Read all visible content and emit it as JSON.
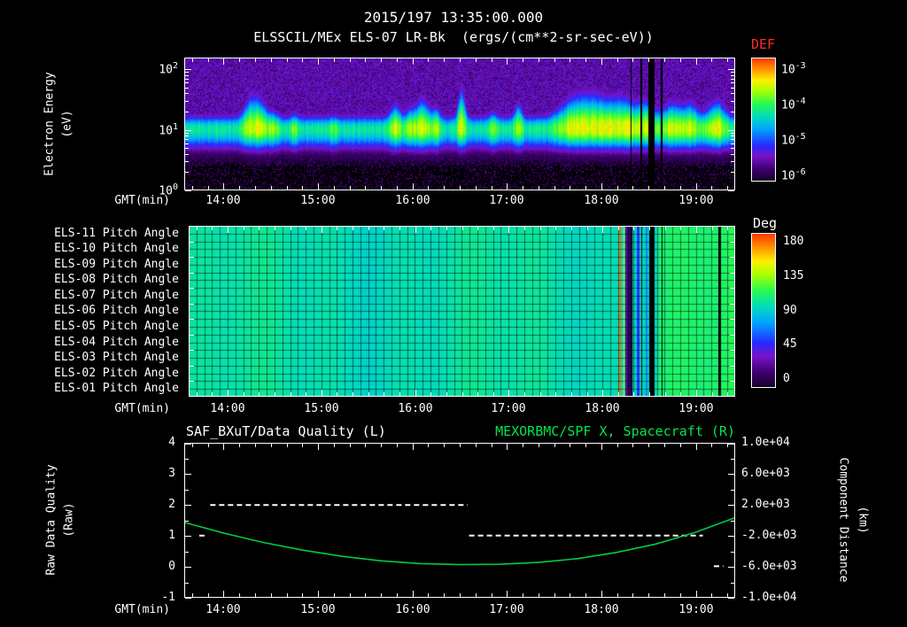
{
  "header": {
    "title": "2015/197 13:35:00.000",
    "subtitle": "ELSSCIL/MEx ELS-07 LR-Bk  (ergs/(cm**2-sr-sec-eV))"
  },
  "time_axis": {
    "label": "GMT(min)",
    "start": "13:35",
    "total_min": 350,
    "major_ticks": [
      {
        "t": 25,
        "label": "14:00"
      },
      {
        "t": 85,
        "label": "15:00"
      },
      {
        "t": 145,
        "label": "16:00"
      },
      {
        "t": 205,
        "label": "17:00"
      },
      {
        "t": 265,
        "label": "18:00"
      },
      {
        "t": 325,
        "label": "19:00"
      }
    ],
    "minor_step_min": 10
  },
  "chart_data": [
    {
      "type": "heatmap",
      "name": "electron-energy-spectrogram",
      "instrument": "ELSSCIL/MEx ELS-07 LR-Bk",
      "units": "ergs/(cm**2-sr-sec-eV)",
      "ylabel": "Electron Energy",
      "ylabel_units": "(eV)",
      "yscale": "log",
      "y_decades": [
        0,
        1,
        2
      ],
      "ymax_log": 2.19,
      "band_center_ev": 10,
      "band_amp": 0.55,
      "colorbar": {
        "label": "DEF",
        "label_color": "#ff2a2a",
        "exponents": [
          -3,
          -4,
          -5,
          -6
        ],
        "range_log": [
          -6,
          -3
        ]
      },
      "features": [
        {
          "t": 43,
          "w": 4,
          "h": 1.75,
          "a": 0.55
        },
        {
          "t": 50,
          "w": 3,
          "h": 1.45,
          "a": 0.4
        },
        {
          "t": 57,
          "w": 2.5,
          "h": 1.3,
          "a": 0.3
        },
        {
          "t": 70,
          "w": 2,
          "h": 1.25,
          "a": 0.3
        },
        {
          "t": 95,
          "w": 2,
          "h": 1.2,
          "a": 0.25
        },
        {
          "t": 134,
          "w": 3,
          "h": 1.5,
          "a": 0.45
        },
        {
          "t": 143,
          "w": 2,
          "h": 1.35,
          "a": 0.35
        },
        {
          "t": 151,
          "w": 4,
          "h": 1.65,
          "a": 0.5
        },
        {
          "t": 160,
          "w": 2,
          "h": 1.4,
          "a": 0.35
        },
        {
          "t": 176,
          "w": 2,
          "h": 1.95,
          "a": 0.5
        },
        {
          "t": 196,
          "w": 2,
          "h": 1.3,
          "a": 0.3
        },
        {
          "t": 212,
          "w": 2,
          "h": 1.55,
          "a": 0.4
        },
        {
          "t": 247,
          "w": 8,
          "h": 1.65,
          "a": 0.5
        },
        {
          "t": 262,
          "w": 8,
          "h": 1.7,
          "a": 0.55
        },
        {
          "t": 278,
          "w": 6,
          "h": 1.65,
          "a": 0.5
        },
        {
          "t": 292,
          "w": 5,
          "h": 1.6,
          "a": 0.5
        },
        {
          "t": 310,
          "w": 6,
          "h": 1.55,
          "a": 0.45
        },
        {
          "t": 322,
          "w": 4,
          "h": 1.5,
          "a": 0.4
        },
        {
          "t": 338,
          "w": 5,
          "h": 1.6,
          "a": 0.5
        }
      ],
      "data_gaps": [
        {
          "t": 283.5,
          "w": 0.7
        },
        {
          "t": 290,
          "w": 0.8
        },
        {
          "t": 296.5,
          "w": 3.5
        },
        {
          "t": 303,
          "w": 0.8
        }
      ]
    },
    {
      "type": "heatmap",
      "name": "pitch-angle-panels",
      "rows": [
        "ELS-11 Pitch Angle",
        "ELS-10 Pitch Angle",
        "ELS-09 Pitch Angle",
        "ELS-08 Pitch Angle",
        "ELS-07 Pitch Angle",
        "ELS-06 Pitch Angle",
        "ELS-05 Pitch Angle",
        "ELS-04 Pitch Angle",
        "ELS-03 Pitch Angle",
        "ELS-02 Pitch Angle",
        "ELS-01 Pitch Angle"
      ],
      "colorbar": {
        "label": "Deg",
        "ticks": [
          180,
          135,
          90,
          45,
          0
        ],
        "range": [
          0,
          180
        ]
      },
      "base_deg_early": 96,
      "base_deg_late": 106,
      "late_start_min": 300,
      "stripes": [
        {
          "t": 276,
          "w": 1.5,
          "deg": 165
        },
        {
          "t": 278.5,
          "w": 1,
          "deg": 140
        },
        {
          "t": 280,
          "w": 1.2,
          "deg": 40
        },
        {
          "t": 282,
          "w": 2.5,
          "deg": 15
        },
        {
          "t": 287.5,
          "w": 1.5,
          "deg": 55
        },
        {
          "t": 293,
          "w": 1,
          "deg": 70
        }
      ],
      "data_gaps": [
        {
          "t": 283.5,
          "w": 0.7
        },
        {
          "t": 290,
          "w": 0.8
        },
        {
          "t": 296.5,
          "w": 3.5
        },
        {
          "t": 303,
          "w": 0.8
        },
        {
          "t": 340,
          "w": 1.8
        }
      ]
    },
    {
      "type": "line",
      "name": "quality-and-distance",
      "title_left": "SAF_BXuT/Data Quality (L)",
      "title_right": "MEXORBMC/SPF X, Spacecraft (R)",
      "title_right_color": "#00e64d",
      "left_axis": {
        "label": "Raw Data Quality",
        "units": "(Raw)",
        "ticks": [
          4,
          3,
          2,
          1,
          0,
          -1
        ],
        "min": -1,
        "max": 4
      },
      "right_axis": {
        "label": "Component Distance",
        "units": "(km)",
        "ticks": [
          "1.0e+04",
          "6.0e+03",
          "2.0e+03",
          "-2.0e+03",
          "-6.0e+03",
          "-1.0e+04"
        ],
        "min": -10000,
        "max": 10000
      },
      "series": [
        {
          "name": "SAF_BXuT/Data Quality",
          "axis": "left",
          "style": "dashed",
          "color": "#ffffff",
          "segments": [
            {
              "t1": 9,
              "t2": 14,
              "value": 1
            },
            {
              "t1": 16,
              "t2": 180,
              "value": 2
            },
            {
              "t1": 181,
              "t2": 330,
              "value": 1
            },
            {
              "t1": 337,
              "t2": 343,
              "value": 0
            }
          ]
        },
        {
          "name": "MEXORBMC/SPF X",
          "axis": "right",
          "style": "solid",
          "color": "#00cc44",
          "t_min": [
            0,
            25,
            50,
            75,
            100,
            125,
            150,
            175,
            200,
            225,
            250,
            275,
            300,
            325,
            350
          ],
          "km": [
            -300,
            -1700,
            -2900,
            -3900,
            -4700,
            -5300,
            -5650,
            -5780,
            -5750,
            -5500,
            -5000,
            -4200,
            -3100,
            -1600,
            300
          ]
        }
      ]
    }
  ]
}
